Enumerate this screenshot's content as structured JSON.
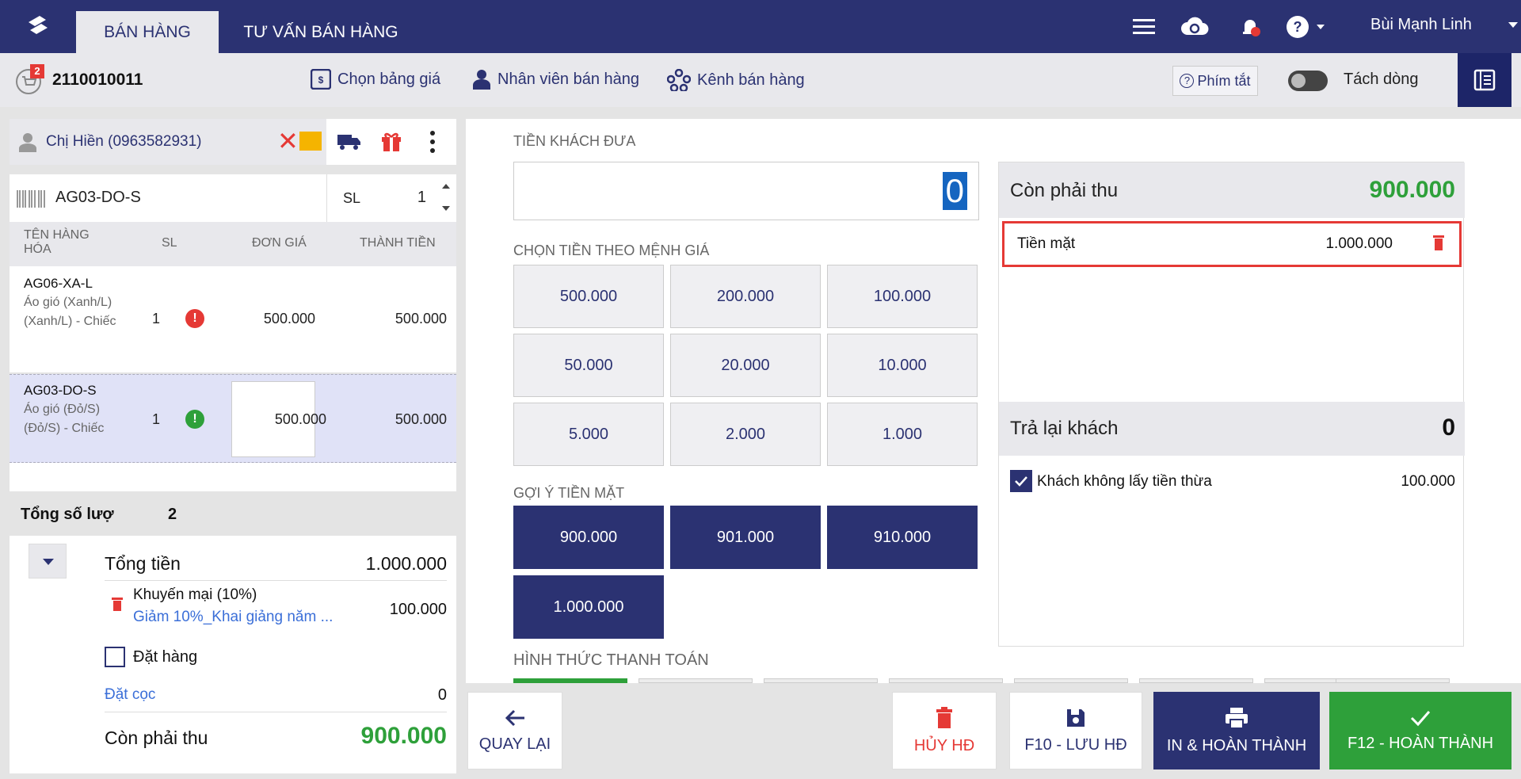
{
  "header": {
    "tabs": [
      {
        "label": "BÁN HÀNG"
      },
      {
        "label": "TƯ VẤN BÁN HÀNG"
      }
    ],
    "user_name": "Bùi Mạnh Linh",
    "icons": [
      "menu-icon",
      "cloud-sync-icon",
      "bell-icon",
      "help-icon"
    ]
  },
  "toolbar": {
    "cart_count": "2",
    "order_id": "2110010011",
    "price_list": "Chọn bảng giá",
    "staff": "Nhân viên bán hàng",
    "channel": "Kênh bán hàng",
    "shortcut": "Phím tắt",
    "split_line": "Tách dòng"
  },
  "customer": {
    "name": "Chị Hiền (0963582931)"
  },
  "sku_entry": {
    "code": "AG03-DO-S",
    "qty_label": "SL",
    "qty": "1"
  },
  "table": {
    "headers": {
      "name": "TÊN HÀNG HÓA",
      "qty": "SL",
      "price": "ĐƠN GIÁ",
      "total": "THÀNH TIỀN"
    },
    "rows": [
      {
        "code": "AG06-XA-L",
        "desc": "Áo gió (Xanh/L) (Xanh/L) - Chiếc",
        "qty": "1",
        "status": "!",
        "price": "500.000",
        "total": "500.000"
      },
      {
        "code": "AG03-DO-S",
        "desc": "Áo gió (Đỏ/S) (Đỏ/S) - Chiếc",
        "qty": "1",
        "status": "!",
        "price": "500.000",
        "total": "500.000"
      }
    ]
  },
  "summary": {
    "total_qty_label": "Tổng số lượ",
    "total_qty": "2",
    "total_label": "Tổng tiền",
    "total": "1.000.000",
    "promo_label": "Khuyến mại (10%)",
    "promo_desc": "Giảm 10%_Khai giảng năm ...",
    "promo_value": "100.000",
    "order_label": "Đặt hàng",
    "deposit_label": "Đặt cọc",
    "deposit": "0",
    "due_label": "Còn phải thu",
    "due": "900.000"
  },
  "payment": {
    "cash_given_label": "TIỀN KHÁCH ĐƯA",
    "cash_given": "0",
    "denom_label": "CHỌN TIỀN THEO MỆNH GIÁ",
    "denoms": [
      "500.000",
      "200.000",
      "100.000",
      "50.000",
      "20.000",
      "10.000",
      "5.000",
      "2.000",
      "1.000"
    ],
    "suggest_label": "GỢI Ý TIỀN MẶT",
    "suggests": [
      "900.000",
      "901.000",
      "910.000",
      "1.000.000"
    ],
    "method_label": "HÌNH THỨC THANH TOÁN"
  },
  "right": {
    "due_label": "Còn phải thu",
    "due": "900.000",
    "cash_label": "Tiền mặt",
    "cash": "1.000.000",
    "change_label": "Trả lại khách",
    "change": "0",
    "no_change_label": "Khách không lấy tiền thừa",
    "no_change_value": "100.000"
  },
  "actions": {
    "back": "QUAY LẠI",
    "cancel": "HỦY HĐ",
    "save": "F10 - LƯU HĐ",
    "print": "IN & HOÀN THÀNH",
    "complete": "F12 - HOÀN THÀNH"
  },
  "colors": {
    "brand": "#2b3272",
    "success": "#2ea03a",
    "danger": "#e53935"
  }
}
